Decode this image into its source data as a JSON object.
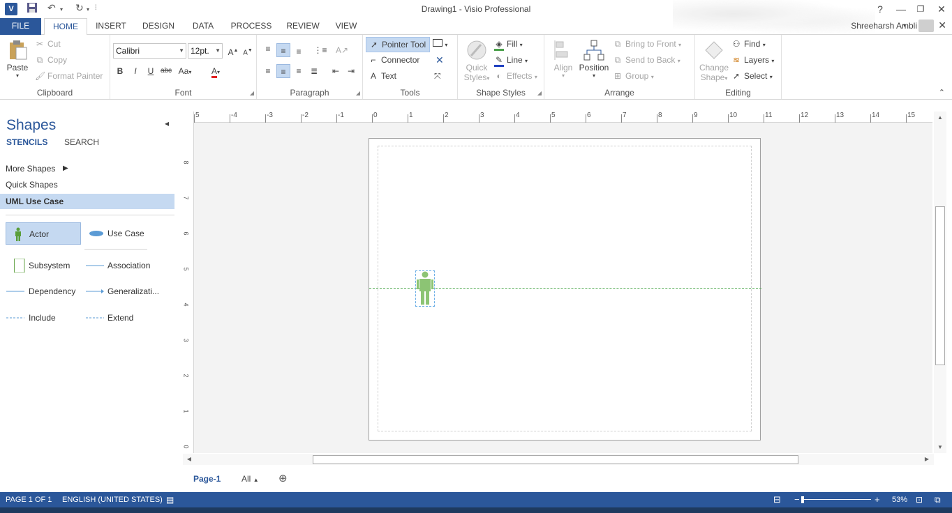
{
  "app": {
    "title": "Drawing1 - Visio Professional",
    "icon_letter": "V",
    "user_name": "Shreeharsh Ambli"
  },
  "window_controls": [
    "?",
    "restore-ribbon",
    "minimize",
    "restore",
    "close"
  ],
  "tabs": [
    {
      "label": "FILE"
    },
    {
      "label": "HOME"
    },
    {
      "label": "INSERT"
    },
    {
      "label": "DESIGN"
    },
    {
      "label": "DATA"
    },
    {
      "label": "PROCESS"
    },
    {
      "label": "REVIEW"
    },
    {
      "label": "VIEW"
    }
  ],
  "ribbon": {
    "clipboard": {
      "label": "Clipboard",
      "paste": "Paste",
      "cut": "Cut",
      "copy": "Copy",
      "format_painter": "Format Painter"
    },
    "font": {
      "label": "Font",
      "font_name": "Calibri",
      "font_size": "12pt.",
      "bold": "B",
      "italic": "I",
      "underline": "U",
      "strike": "abc",
      "case": "Aa"
    },
    "paragraph": {
      "label": "Paragraph"
    },
    "tools": {
      "label": "Tools",
      "pointer": "Pointer Tool",
      "connector": "Connector",
      "text": "Text"
    },
    "shape_styles": {
      "label": "Shape Styles",
      "quick_styles_1": "Quick",
      "quick_styles_2": "Styles",
      "fill": "Fill",
      "line": "Line",
      "effects": "Effects"
    },
    "arrange": {
      "label": "Arrange",
      "align": "Align",
      "position": "Position",
      "bring_front": "Bring to Front",
      "send_back": "Send to Back",
      "group": "Group"
    },
    "editing": {
      "label": "Editing",
      "change_shape_1": "Change",
      "change_shape_2": "Shape",
      "find": "Find",
      "layers": "Layers",
      "select": "Select"
    }
  },
  "shapes_pane": {
    "title": "Shapes",
    "tab_stencils": "STENCILS",
    "tab_search": "SEARCH",
    "nav": [
      "More Shapes",
      "Quick Shapes",
      "UML Use Case"
    ],
    "items": [
      {
        "label": "Actor"
      },
      {
        "label": "Use Case"
      },
      {
        "label": "Subsystem"
      },
      {
        "label": "Association"
      },
      {
        "label": "Dependency"
      },
      {
        "label": "Generalizati..."
      },
      {
        "label": "Include"
      },
      {
        "label": "Extend"
      }
    ]
  },
  "rulers": {
    "horizontal": [
      "5",
      "-4",
      "-3",
      "-2",
      "-1",
      "0",
      "1",
      "2",
      "3",
      "4",
      "5",
      "6",
      "7",
      "8",
      "9",
      "10",
      "11",
      "12",
      "13",
      "14",
      "15"
    ],
    "vertical": [
      "8",
      "7",
      "6",
      "5",
      "4",
      "3",
      "2",
      "1",
      "0"
    ]
  },
  "page_tabs": {
    "current": "Page-1",
    "all": "All"
  },
  "status": {
    "page": "PAGE 1 OF 1",
    "language": "ENGLISH (UNITED STATES)",
    "zoom_text": "53%",
    "zoom_level": 0.53
  },
  "colors": {
    "accent": "#2b579a",
    "selection": "#c5d9f1",
    "actor_green": "#8cc474",
    "guide_green": "#5aae5a"
  }
}
